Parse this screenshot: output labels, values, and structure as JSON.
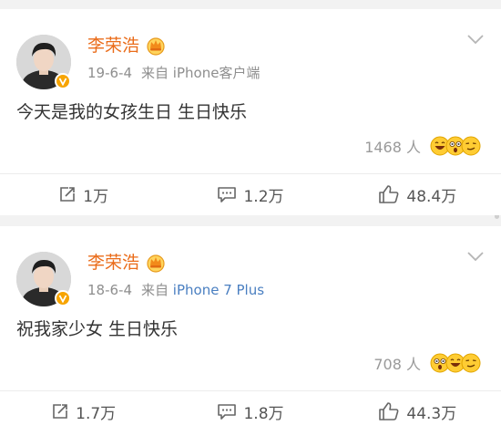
{
  "posts": [
    {
      "author": "李荣浩",
      "date": "19-6-4",
      "source_prefix": "来自",
      "source": "iPhone客户端",
      "source_is_link": false,
      "text": "今天是我的女孩生日 生日快乐",
      "reaction_count": "1468 人",
      "reposts": "1万",
      "comments": "1.2万",
      "likes": "48.4万"
    },
    {
      "author": "李荣浩",
      "date": "18-6-4",
      "source_prefix": "来自",
      "source": "iPhone 7 Plus",
      "source_is_link": true,
      "text": "祝我家少女 生日快乐",
      "reaction_count": "708 人",
      "reposts": "1.7万",
      "comments": "1.8万",
      "likes": "44.3万"
    }
  ],
  "colors": {
    "author_name": "#ea6c1a",
    "meta_text": "#8e8e8e",
    "source_link": "#4a7fc1",
    "verified_badge": "#f7a400",
    "background": "#f2f2f2"
  },
  "icons": {
    "member": "crown-icon",
    "verified": "verified-v-icon",
    "menu": "chevron-down-icon",
    "repost": "repost-icon",
    "comment": "comment-icon",
    "like": "thumbs-up-icon",
    "reactions": [
      "laugh-emoji-icon",
      "surprised-emoji-icon",
      "smirk-emoji-icon"
    ]
  }
}
